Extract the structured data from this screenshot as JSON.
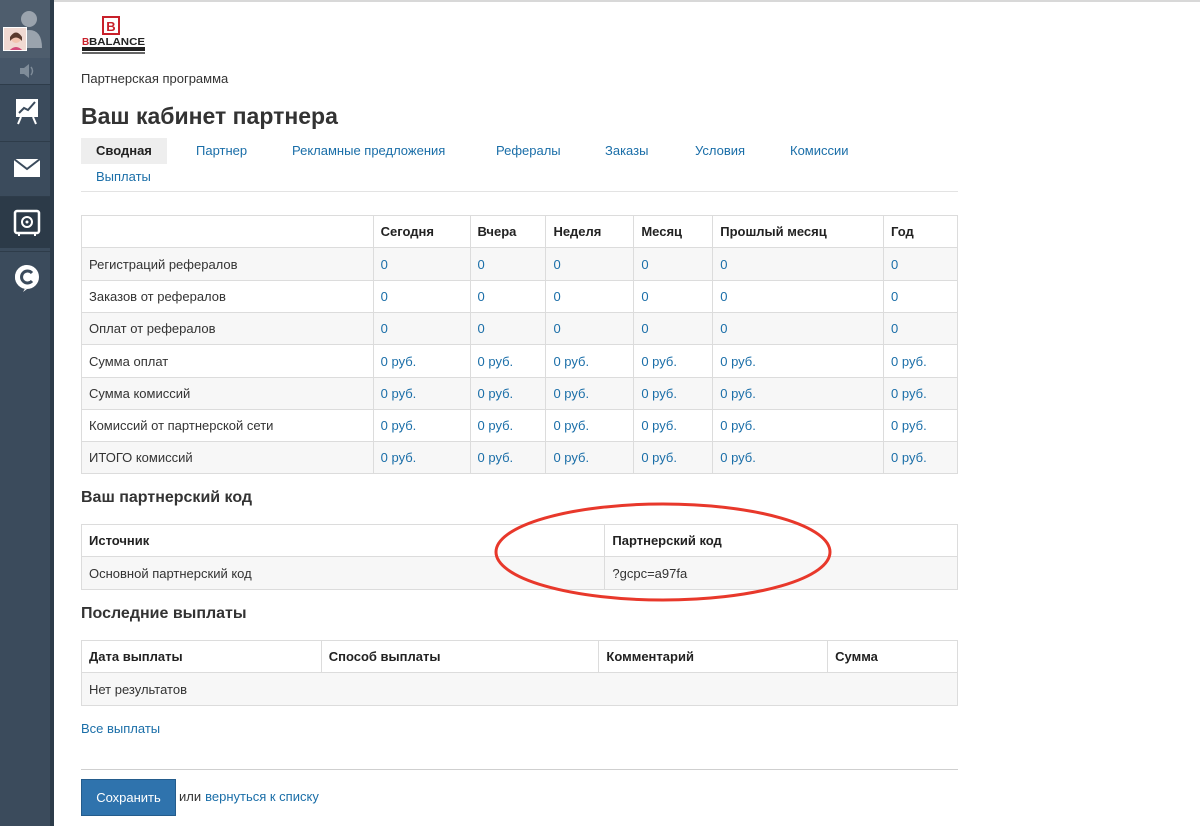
{
  "brand": {
    "logo_text": "BBALANCE",
    "logo_sub": "INTERNATIONAL TRAINING CENTER"
  },
  "sidebar": {
    "items": [
      {
        "icon": "chart-board-icon"
      },
      {
        "icon": "mail-icon"
      },
      {
        "icon": "safe-icon"
      },
      {
        "icon": "chat-c-icon"
      }
    ]
  },
  "breadcrumb": "Партнерская программа",
  "page_title": "Ваш кабинет партнера",
  "tabs": [
    {
      "label": "Сводная",
      "active": true
    },
    {
      "label": "Партнер"
    },
    {
      "label": "Рекламные предложения"
    },
    {
      "label": "Рефералы"
    },
    {
      "label": "Заказы"
    },
    {
      "label": "Условия"
    },
    {
      "label": "Комиссии"
    },
    {
      "label": "Выплаты"
    }
  ],
  "summary": {
    "headers": [
      "",
      "Сегодня",
      "Вчера",
      "Неделя",
      "Месяц",
      "Прошлый месяц",
      "Год"
    ],
    "rows": [
      {
        "label": "Регистраций рефералов",
        "values": [
          "0",
          "0",
          "0",
          "0",
          "0",
          "0"
        ]
      },
      {
        "label": "Заказов от рефералов",
        "values": [
          "0",
          "0",
          "0",
          "0",
          "0",
          "0"
        ]
      },
      {
        "label": "Оплат от рефералов",
        "values": [
          "0",
          "0",
          "0",
          "0",
          "0",
          "0"
        ]
      },
      {
        "label": "Сумма оплат",
        "values": [
          "0 руб.",
          "0 руб.",
          "0 руб.",
          "0 руб.",
          "0 руб.",
          "0 руб."
        ]
      },
      {
        "label": "Сумма комиссий",
        "values": [
          "0 руб.",
          "0 руб.",
          "0 руб.",
          "0 руб.",
          "0 руб.",
          "0 руб."
        ]
      },
      {
        "label": "Комиссий от партнерской сети",
        "values": [
          "0 руб.",
          "0 руб.",
          "0 руб.",
          "0 руб.",
          "0 руб.",
          "0 руб."
        ]
      },
      {
        "label": "ИТОГО комиссий",
        "values": [
          "0 руб.",
          "0 руб.",
          "0 руб.",
          "0 руб.",
          "0 руб.",
          "0 руб."
        ]
      }
    ]
  },
  "partner_code": {
    "title": "Ваш партнерский код",
    "headers": [
      "Источник",
      "Партнерский код"
    ],
    "rows": [
      {
        "source": "Основной партнерский код",
        "code": "?gcpc=a97fa"
      }
    ]
  },
  "payouts": {
    "title": "Последние выплаты",
    "headers": [
      "Дата выплаты",
      "Способ выплаты",
      "Комментарий",
      "Сумма"
    ],
    "empty_text": "Нет результатов",
    "all_link": "Все выплаты"
  },
  "footer": {
    "save_label": "Сохранить",
    "or_text": "или",
    "back_link": "вернуться к списку"
  },
  "colors": {
    "link": "#1a6ea8",
    "sidebar": "#3b4b5c",
    "button": "#2f73ad",
    "highlight": "#e8382b"
  }
}
